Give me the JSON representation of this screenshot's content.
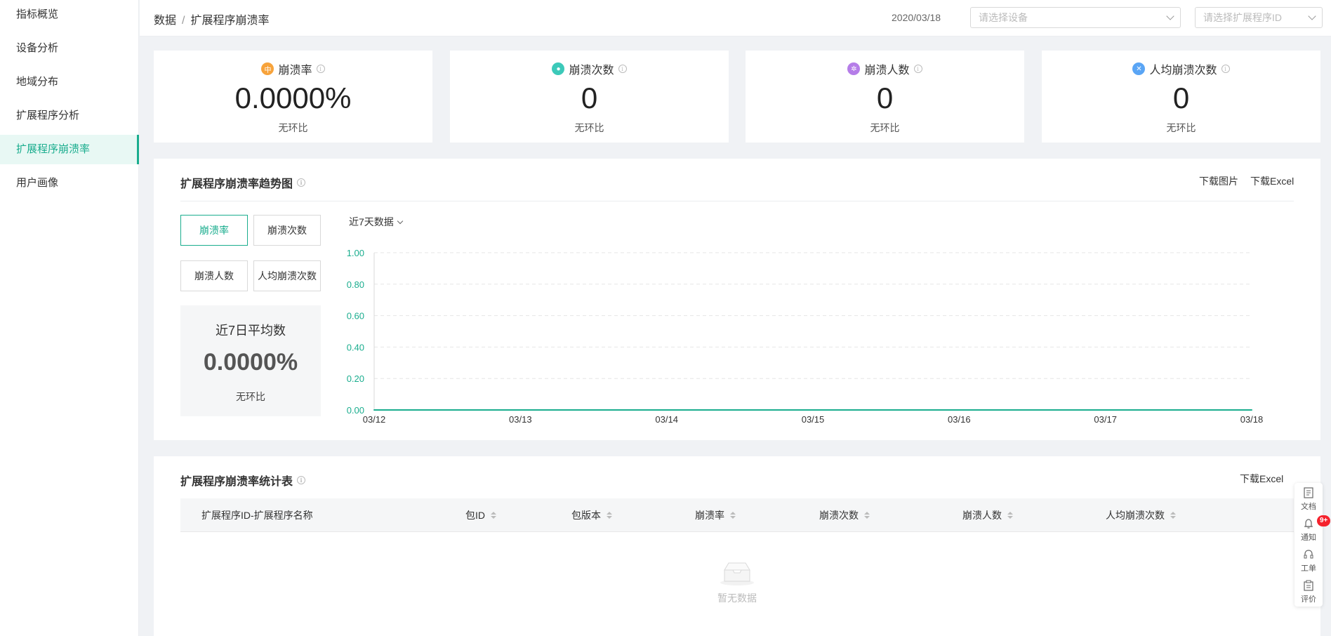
{
  "sidebar": {
    "items": [
      {
        "label": "指标概览"
      },
      {
        "label": "设备分析"
      },
      {
        "label": "地域分布"
      },
      {
        "label": "扩展程序分析"
      },
      {
        "label": "扩展程序崩溃率",
        "active": true
      },
      {
        "label": "用户画像"
      }
    ]
  },
  "header": {
    "breadcrumb_root": "数据",
    "breadcrumb_sep": "/",
    "breadcrumb_current": "扩展程序崩溃率",
    "date": "2020/03/18",
    "device_placeholder": "请选择设备",
    "extension_placeholder": "请选择扩展程序ID"
  },
  "cards": [
    {
      "title": "崩溃率",
      "value": "0.0000%",
      "sub": "无环比",
      "icon_color": "#f7a33b",
      "icon": "rate-icon"
    },
    {
      "title": "崩溃次数",
      "value": "0",
      "sub": "无环比",
      "icon_color": "#3cc9b9",
      "icon": "count-icon"
    },
    {
      "title": "崩溃人数",
      "value": "0",
      "sub": "无环比",
      "icon_color": "#b57de8",
      "icon": "users-icon"
    },
    {
      "title": "人均崩溃次数",
      "value": "0",
      "sub": "无环比",
      "icon_color": "#5aa5f5",
      "icon": "per-user-icon"
    }
  ],
  "trend": {
    "title": "扩展程序崩溃率趋势图",
    "download_image": "下载图片",
    "download_excel": "下载Excel",
    "buttons": [
      {
        "label": "崩溃率",
        "active": true
      },
      {
        "label": "崩溃次数"
      },
      {
        "label": "崩溃人数"
      },
      {
        "label": "人均崩溃次数"
      }
    ],
    "avg_title": "近7日平均数",
    "avg_value": "0.0000%",
    "avg_sub": "无环比",
    "range_label": "近7天数据"
  },
  "chart_data": {
    "type": "line",
    "categories": [
      "03/12",
      "03/13",
      "03/14",
      "03/15",
      "03/16",
      "03/17",
      "03/18"
    ],
    "series": [
      {
        "values": [
          0,
          0,
          0,
          0,
          0,
          0,
          0
        ],
        "color": "#1aad8e"
      }
    ],
    "y_ticks": [
      "0.00",
      "0.20",
      "0.40",
      "0.60",
      "0.80",
      "1.00"
    ],
    "ylim": [
      0,
      1
    ],
    "grid": true,
    "tick_color": "#1aad8e"
  },
  "table": {
    "title": "扩展程序崩溃率统计表",
    "download_excel": "下载Excel",
    "columns": [
      "扩展程序ID-扩展程序名称",
      "包ID",
      "包版本",
      "崩溃率",
      "崩溃次数",
      "崩溃人数",
      "人均崩溃次数"
    ],
    "empty_text": "暂无数据"
  },
  "float_bar": {
    "items": [
      {
        "label": "文档"
      },
      {
        "label": "通知"
      },
      {
        "label": "工单"
      },
      {
        "label": "评价"
      }
    ],
    "badge": "9+"
  }
}
